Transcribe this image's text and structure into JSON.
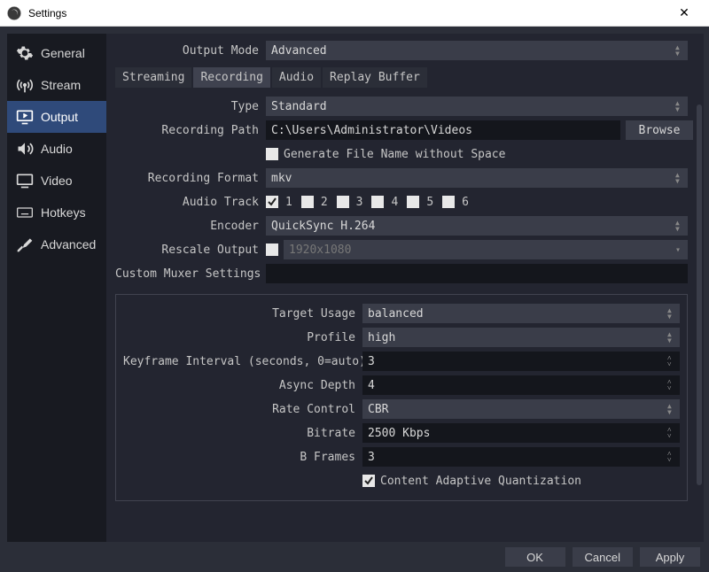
{
  "window": {
    "title": "Settings"
  },
  "sidebar": {
    "items": [
      {
        "label": "General"
      },
      {
        "label": "Stream"
      },
      {
        "label": "Output"
      },
      {
        "label": "Audio"
      },
      {
        "label": "Video"
      },
      {
        "label": "Hotkeys"
      },
      {
        "label": "Advanced"
      }
    ]
  },
  "output_mode": {
    "label": "Output Mode",
    "value": "Advanced"
  },
  "tabs": [
    {
      "label": "Streaming"
    },
    {
      "label": "Recording"
    },
    {
      "label": "Audio"
    },
    {
      "label": "Replay Buffer"
    }
  ],
  "recording": {
    "type": {
      "label": "Type",
      "value": "Standard"
    },
    "path": {
      "label": "Recording Path",
      "value": "C:\\Users\\Administrator\\Videos",
      "browse": "Browse"
    },
    "gen_no_space": {
      "label": "Generate File Name without Space",
      "checked": false
    },
    "format": {
      "label": "Recording Format",
      "value": "mkv"
    },
    "audio_track": {
      "label": "Audio Track",
      "tracks": [
        "1",
        "2",
        "3",
        "4",
        "5",
        "6"
      ],
      "checked": [
        true,
        false,
        false,
        false,
        false,
        false
      ]
    },
    "encoder": {
      "label": "Encoder",
      "value": "QuickSync H.264"
    },
    "rescale": {
      "label": "Rescale Output",
      "checked": false,
      "value": "1920x1080"
    },
    "muxer": {
      "label": "Custom Muxer Settings",
      "value": ""
    }
  },
  "encoder_panel": {
    "target_usage": {
      "label": "Target Usage",
      "value": "balanced"
    },
    "profile": {
      "label": "Profile",
      "value": "high"
    },
    "keyframe": {
      "label": "Keyframe Interval (seconds, 0=auto)",
      "value": "3"
    },
    "async_depth": {
      "label": "Async Depth",
      "value": "4"
    },
    "rate_control": {
      "label": "Rate Control",
      "value": "CBR"
    },
    "bitrate": {
      "label": "Bitrate",
      "value": "2500 Kbps"
    },
    "b_frames": {
      "label": "B Frames",
      "value": "3"
    },
    "caq": {
      "label": "Content Adaptive Quantization",
      "checked": true
    }
  },
  "footer": {
    "ok": "OK",
    "cancel": "Cancel",
    "apply": "Apply"
  }
}
